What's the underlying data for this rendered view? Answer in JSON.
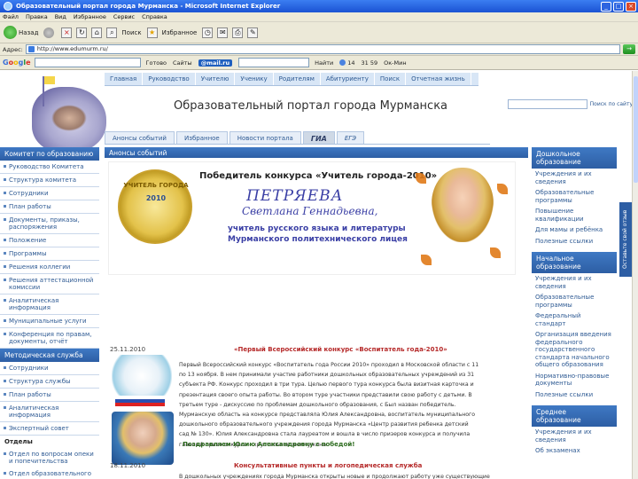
{
  "window": {
    "title": "Образовательный портал города Мурманска - Microsoft Internet Explorer"
  },
  "menu": [
    "Файл",
    "Правка",
    "Вид",
    "Избранное",
    "Сервис",
    "Справка"
  ],
  "toolbar": {
    "back": "Назад",
    "search": "Поиск",
    "favorites": "Избранное"
  },
  "address": {
    "label": "Адрес:",
    "url": "http://www.edumurm.ru/",
    "go": "→"
  },
  "googlebar": {
    "logo": [
      "G",
      "o",
      "o",
      "g",
      "l",
      "e"
    ],
    "find": "Найти",
    "items": [
      "Готово",
      "Сайты",
      "@mail.ru",
      "Найти",
      "14",
      "31 59",
      "Ок-Мин"
    ]
  },
  "site": {
    "nav": [
      "Главная",
      "Руководство",
      "Учителю",
      "Ученику",
      "Родителям",
      "Абитуриенту",
      "Поиск",
      "Отчетная жизнь"
    ],
    "title": "Образовательный портал города Мурманска",
    "search_go": "Поиск по сайту",
    "subtabs": [
      "Анонсы событий",
      "Избранное",
      "Новости портала",
      "ГИА",
      "ЕГЭ"
    ]
  },
  "left": {
    "head1": "Комитет по образованию",
    "items1": [
      "Руководство Комитета",
      "Структура комитета",
      "Сотрудники",
      "План работы",
      "Документы, приказы, распоряжения",
      "Положение",
      "Программы",
      "Решения коллегии",
      "Решения аттестационной комиссии",
      "Аналитическая информация",
      "Муниципальные услуги",
      "Конференция по правам, документы, отчёт"
    ],
    "head2": "Методическая служба",
    "items2": [
      "Сотрудники",
      "Структура службы",
      "План работы",
      "Аналитическая информация",
      "Экспертный совет"
    ],
    "group": "Отделы",
    "items3": [
      "Отдел по вопросам опеки и попечительства",
      "Отдел образовательного процесса"
    ]
  },
  "center": {
    "head": "Анонсы событий",
    "promo": {
      "medal_text": "УЧИТЕЛЬ ГОРОДА",
      "medal_year": "2010",
      "headline": "Победитель конкурса «Учитель города-2010»",
      "surname": "ПЕТРЯЕВА",
      "given": "Светлана Геннадьевна,",
      "role1": "учитель русского языка и литературы",
      "role2": "Мурманского политехнического лицея"
    },
    "news1": {
      "date": "25.11.2010",
      "title": "«Первый Всероссийский конкурс «Воспитатель года-2010»",
      "p1": "Первый Всероссийский конкурс «Воспитатель года России 2010» проходил в Московской области с 11 по 13 ноября. В нем принимали участие работники дошкольных образовательных учреждений из 31 субъекта РФ. Конкурс проходил в три тура. Целью первого тура конкурса была визитная карточка и презентация своего опыта работы. Во втором туре участники представили свою работу с детьми. В третьем туре - дискуссию по проблемам дошкольного образования, с Был назван победитель.",
      "p2": "Мурманскую область на конкурсе представляла Юлия Александровна, воспитатель муниципального дошкольного образовательного учреждения города Мурманска «Центр развития ребенка детский сад № 130». Юлия Александровна стала лауреатом и вошла в число призеров конкурса и получила главный приз конкурса – хрустальное жемчужина.",
      "congrats": "Поздравляем Юлию Александровну с победой!"
    },
    "news2": {
      "date": "18.11.2010",
      "title": "Консультативные пункты и логопедическая служба",
      "p1": "В дошкольных учреждениях города Мурманска открыты новые и продолжают работу уже существующие консультативные пункты для родителей (законных представителей) детей, не посещающих дошкольные учреждения."
    }
  },
  "right": {
    "head1": "Дошкольное образование",
    "items1": [
      "Учреждения и их сведения",
      "Образовательные программы",
      "Повышение квалификации",
      "Для мамы и ребёнка",
      "Полезные ссылки"
    ],
    "head2": "Начальное образование",
    "items2": [
      "Учреждения и их сведения",
      "Образовательные программы",
      "Федеральный стандарт",
      "Организация введения федерального государственного стандарта начального общего образования",
      "Нормативно-правовые документы",
      "Полезные ссылки"
    ],
    "head3": "Среднее образование",
    "items3": [
      "Учреждения и их сведения",
      "Об экзаменах"
    ],
    "feedback": "Оставьте свой отзыв"
  }
}
